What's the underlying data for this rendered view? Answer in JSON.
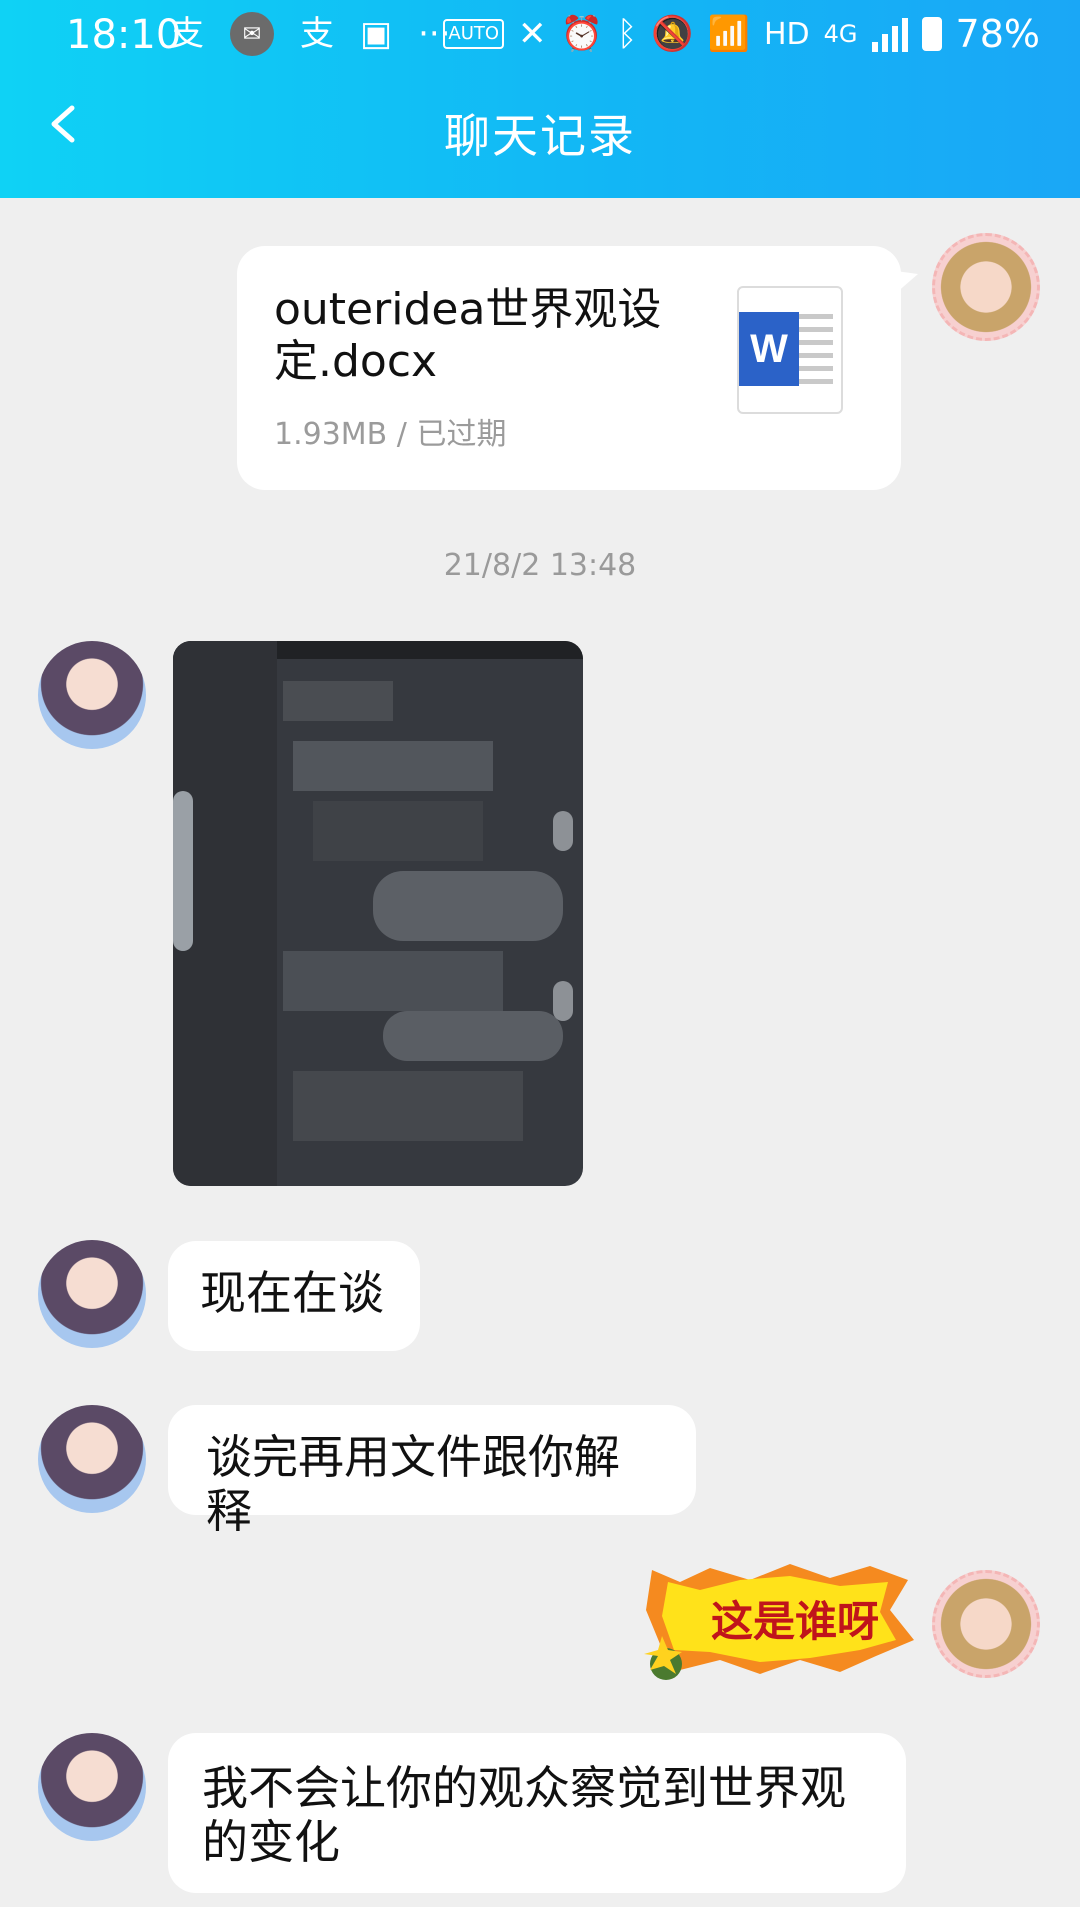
{
  "status_bar": {
    "time": "18:10",
    "battery": "78%",
    "network": "4G",
    "hd": "HD",
    "auto_label": "AUTO"
  },
  "header": {
    "title": "聊天记录",
    "back_icon": "chevron-left-icon"
  },
  "messages": {
    "file": {
      "name": "outeridea世界观设定.docx",
      "meta": "1.93MB / 已过期",
      "icon": "word-doc-icon",
      "icon_letter": "W"
    },
    "timestamp": "21/8/2 13:48",
    "text1": "现在在谈",
    "text2": "谈完再用文件跟你解释",
    "sticker_text": "这是谁呀",
    "text3": "我不会让你的观众察觉到世界观的变化"
  },
  "colors": {
    "header": "#12b7f5",
    "background": "#efefef",
    "bubble": "#ffffff",
    "sticker_yellow": "#ffe21a",
    "sticker_text": "#c0141b"
  }
}
